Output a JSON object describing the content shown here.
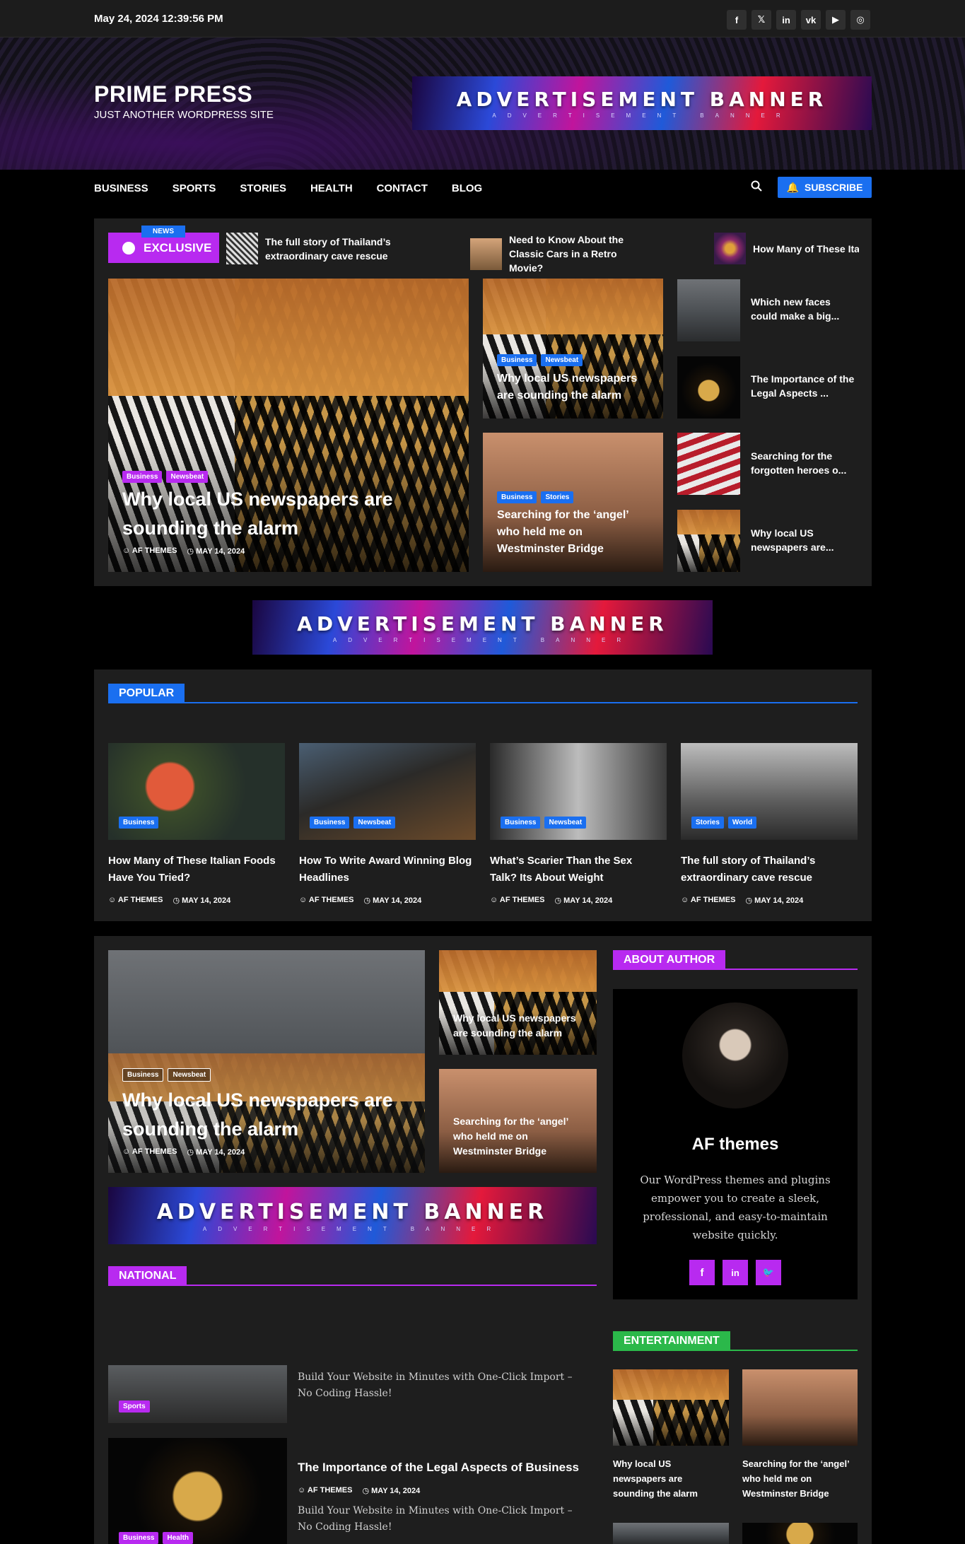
{
  "topbar": {
    "date": "May 24, 2024 12:39:56 PM",
    "social": [
      {
        "icon": "facebook-icon",
        "glyph": "f"
      },
      {
        "icon": "x-icon",
        "glyph": "𝕏"
      },
      {
        "icon": "linkedin-icon",
        "glyph": "in"
      },
      {
        "icon": "vk-icon",
        "glyph": "vk"
      },
      {
        "icon": "youtube-icon",
        "glyph": "▶"
      },
      {
        "icon": "instagram-icon",
        "glyph": "◎"
      }
    ]
  },
  "header": {
    "site_title": "PRIME PRESS",
    "tagline": "JUST ANOTHER WORDPRESS SITE",
    "ad": {
      "title": "ADVERTISEMENT BANNER",
      "subtitle": "ADVERTISEMENT BANNER"
    }
  },
  "nav": {
    "items": [
      "BUSINESS",
      "SPORTS",
      "STORIES",
      "HEALTH",
      "CONTACT",
      "BLOG"
    ],
    "subscribe": "SUBSCRIBE"
  },
  "ticker": {
    "tag": "NEWS",
    "label": "EXCLUSIVE",
    "items": [
      "The full story of Thailand’s extraordinary cave rescue",
      "Need to Know About the Classic Cars in a Retro Movie?",
      "How Many of These Italian Foods Have You Tried?"
    ]
  },
  "featured": {
    "main": {
      "cats": [
        "Business",
        "Newsbeat"
      ],
      "title": "Why local US newspapers are sounding the alarm",
      "author": "AF THEMES",
      "date": "MAY 14, 2024"
    },
    "mid1": {
      "cats": [
        "Business",
        "Newsbeat"
      ],
      "title": "Why local US newspapers are sounding the alarm"
    },
    "mid2": {
      "cats": [
        "Business",
        "Stories"
      ],
      "title": "Searching for the ‘angel’ who held me on Westminster Bridge"
    },
    "side": [
      "Which new faces could make a big...",
      "The Importance of the Legal Aspects ...",
      "Searching for the forgotten heroes o...",
      "Why local US newspapers are..."
    ]
  },
  "ad_mid": {
    "title": "ADVERTISEMENT BANNER",
    "subtitle": "ADVERTISEMENT BANNER"
  },
  "popular": {
    "heading": "POPULAR",
    "posts": [
      {
        "cats": [
          "Business"
        ],
        "title": "How Many of These Italian Foods Have You Tried?",
        "author": "AF THEMES",
        "date": "MAY 14, 2024"
      },
      {
        "cats": [
          "Business",
          "Newsbeat"
        ],
        "title": "How To Write Award Winning Blog Headlines",
        "author": "AF THEMES",
        "date": "MAY 14, 2024"
      },
      {
        "cats": [
          "Business",
          "Newsbeat"
        ],
        "title": "What’s Scarier Than the Sex Talk? Its About Weight",
        "author": "AF THEMES",
        "date": "MAY 14, 2024"
      },
      {
        "cats": [
          "Stories",
          "World"
        ],
        "title": "The full story of Thailand’s extraordinary cave rescue",
        "author": "AF THEMES",
        "date": "MAY 14, 2024"
      }
    ]
  },
  "lower": {
    "main": {
      "cats": [
        "Business",
        "Newsbeat"
      ],
      "title": "Why local US newspapers are sounding the alarm",
      "author": "AF THEMES",
      "date": "MAY 14, 2024"
    },
    "small1": "Why local US newspapers are sounding the alarm",
    "small2": "Searching for the ‘angel’ who held me on Westminster Bridge",
    "ad": {
      "title": "ADVERTISEMENT BANNER",
      "subtitle": "ADVERTISEMENT BANNER"
    }
  },
  "national": {
    "heading": "NATIONAL",
    "item1": {
      "cat": "Sports",
      "excerpt": "Build Your Website in Minutes with One-Click Import – No Coding Hassle!"
    },
    "item2": {
      "cats": [
        "Business",
        "Health"
      ],
      "title": "The Importance of the Legal Aspects of Business",
      "author": "AF THEMES",
      "date": "MAY 14, 2024",
      "excerpt": "Build Your Website in Minutes with One-Click Import – No Coding Hassle!"
    }
  },
  "author": {
    "heading": "ABOUT AUTHOR",
    "name": "AF themes",
    "bio": "Our WordPress themes and plugins empower you to create a sleek, professional, and easy-to-maintain website quickly.",
    "social": [
      {
        "icon": "facebook-icon",
        "glyph": "f"
      },
      {
        "icon": "linkedin-icon",
        "glyph": "in"
      },
      {
        "icon": "twitter-icon",
        "glyph": "🐦"
      }
    ]
  },
  "entertainment": {
    "heading": "ENTERTAINMENT",
    "posts": [
      "Why local US newspapers are sounding the alarm",
      "Searching for the ‘angel’ who held me on Westminster Bridge"
    ]
  },
  "colors": {
    "accent_purple": "#b82af0",
    "accent_blue": "#1a6ff0",
    "accent_green": "#2bb84a"
  }
}
